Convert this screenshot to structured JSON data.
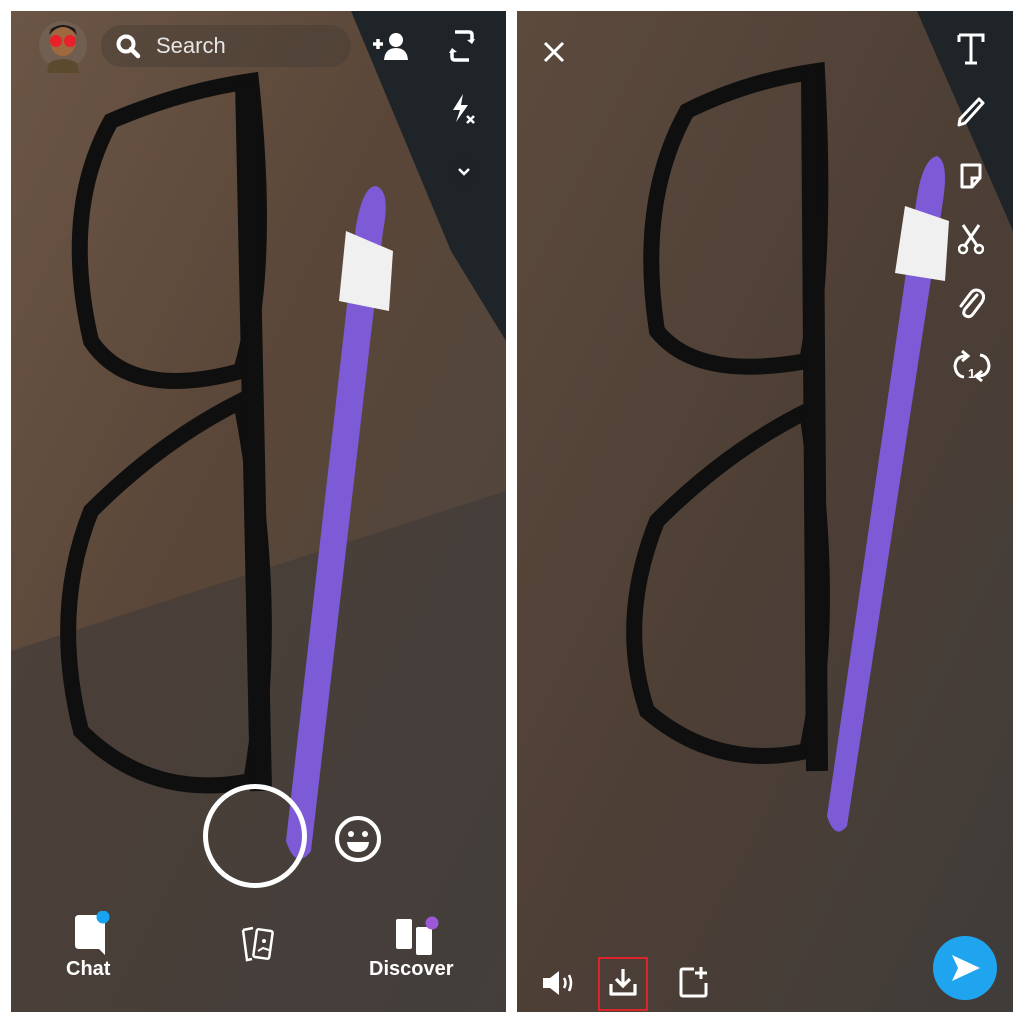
{
  "camera_screen": {
    "search": {
      "placeholder": "Search",
      "icon": "search-icon"
    },
    "top_right_icons": [
      "add-friend-icon",
      "flip-camera-icon",
      "flash-off-icon",
      "chevron-down-icon"
    ],
    "avatar": "bitmoji-avatar",
    "shutter": "capture-button",
    "lens_button": "smiley-icon",
    "nav": {
      "chat_label": "Chat",
      "discover_label": "Discover",
      "memories_icon": "memories-cards-icon",
      "chat_badge_color": "#16a3f2",
      "discover_badge_color": "#9b59d6"
    }
  },
  "preview_screen": {
    "close_icon": "close-icon",
    "tools": [
      "text-tool-icon",
      "pencil-icon",
      "sticker-icon",
      "scissors-icon",
      "paperclip-icon",
      "loop-icon"
    ],
    "loop_badge": "1",
    "bottom": [
      "sound-icon",
      "save-download-icon",
      "add-to-story-icon"
    ],
    "send_button_color": "#1fa4ef",
    "highlight_color": "#d9252b"
  }
}
